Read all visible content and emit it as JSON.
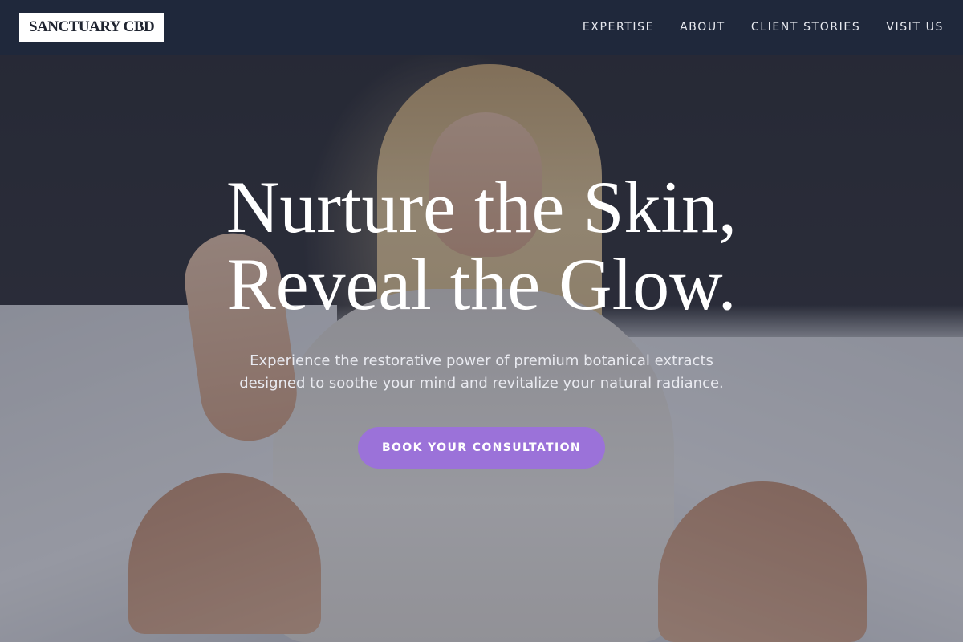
{
  "header": {
    "logo": "SANCTUARY CBD",
    "nav": [
      {
        "label": "EXPERTISE"
      },
      {
        "label": "ABOUT"
      },
      {
        "label": "CLIENT STORIES"
      },
      {
        "label": "VISIT US"
      }
    ]
  },
  "hero": {
    "headline_line1": "Nurture the Skin,",
    "headline_line2": "Reveal the Glow.",
    "subtitle_line1": "Experience the restorative power of premium botanical extracts",
    "subtitle_line2": "designed to soothe your mind and revitalize your natural radiance.",
    "cta_label": "BOOK YOUR CONSULTATION"
  },
  "colors": {
    "header_bg": "#1e283c",
    "accent": "#9b72d9",
    "text_light": "#ffffff"
  }
}
